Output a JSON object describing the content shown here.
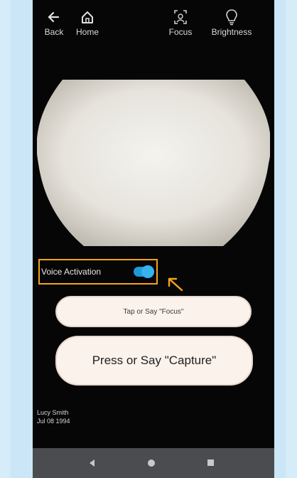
{
  "topbar": {
    "back_label": "Back",
    "home_label": "Home",
    "focus_label": "Focus",
    "brightness_label": "Brightness"
  },
  "voice": {
    "label": "Voice Activation",
    "enabled": true
  },
  "buttons": {
    "focus_label": "Tap or Say \"Focus\"",
    "capture_label": "Press or Say \"Capture\""
  },
  "patient": {
    "name": "Lucy Smith",
    "dob": "Jul 08 1994"
  },
  "colors": {
    "highlight": "#f5a31a",
    "toggle": "#1e9ad6",
    "screen_bg": "#060606",
    "pill_bg": "#fbf2ec"
  },
  "icons": {
    "back": "arrow-left-icon",
    "home": "home-icon",
    "focus": "focus-frame-icon",
    "brightness": "lightbulb-icon"
  }
}
